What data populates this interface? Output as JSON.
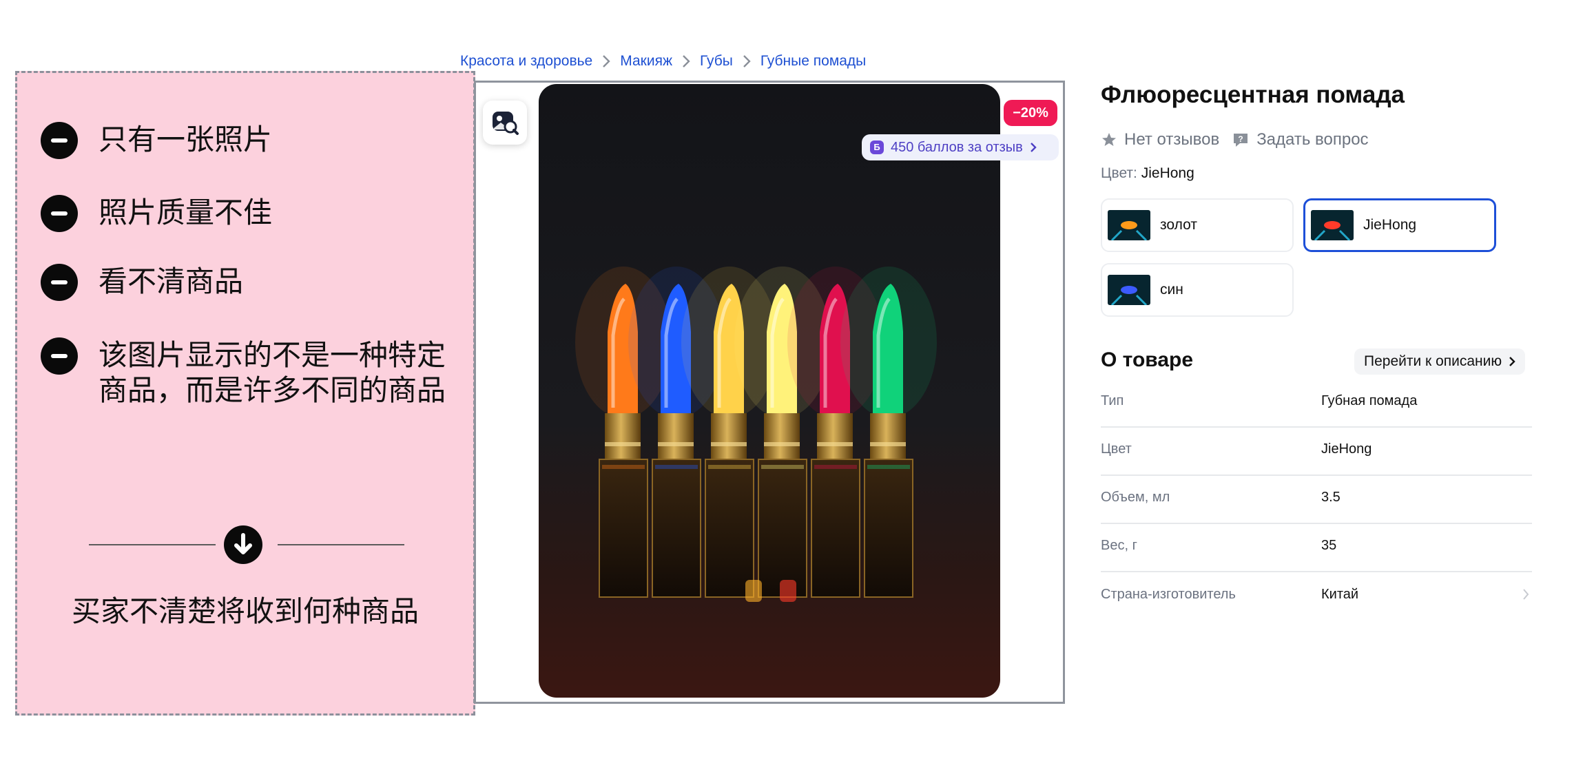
{
  "annotation": {
    "issues": [
      "只有一张照片",
      "照片质量不佳",
      "看不清商品",
      "该图片显示的不是一种特定商品，而是许多不同的商品"
    ],
    "conclusion": "买家不清楚将收到何种商品",
    "colors": {
      "panel_bg": "#fcd1dd",
      "icon": "#0a0a0a"
    }
  },
  "breadcrumb": [
    "Красота и здоровье",
    "Макияж",
    "Губы",
    "Губные помады"
  ],
  "gallery": {
    "discount": "−20%",
    "points_badge": "450 баллов за отзыв",
    "points_icon_letter": "Б",
    "lipstick_colors": [
      "#ff7a1a",
      "#1f5cff",
      "#ffd24a",
      "#fff27a",
      "#e0104e",
      "#10d27a"
    ]
  },
  "product": {
    "title": "Флюоресцентная помада",
    "reviews_link": "Нет отзывов",
    "question_link": "Задать вопрос",
    "color_label": "Цвет:",
    "color_value": "JieHong",
    "swatches": [
      {
        "label": "золот",
        "selected": false,
        "lip_color": "#ff9a1a"
      },
      {
        "label": "JieHong",
        "selected": true,
        "lip_color": "#ff3b2a"
      },
      {
        "label": "син",
        "selected": false,
        "lip_color": "#3c5bff"
      }
    ]
  },
  "about": {
    "title": "О товаре",
    "go_to_description": "Перейти к описанию",
    "specs": [
      {
        "key": "Тип",
        "value": "Губная помада"
      },
      {
        "key": "Цвет",
        "value": "JieHong"
      },
      {
        "key": "Объем, мл",
        "value": "3.5"
      },
      {
        "key": "Вес, г",
        "value": "35"
      },
      {
        "key": "Страна-изготовитель",
        "value": "Китай"
      }
    ]
  },
  "colors": {
    "link": "#1e50d2",
    "accent_badge": "#ef1a55",
    "selected_border": "#1d4fd8"
  }
}
